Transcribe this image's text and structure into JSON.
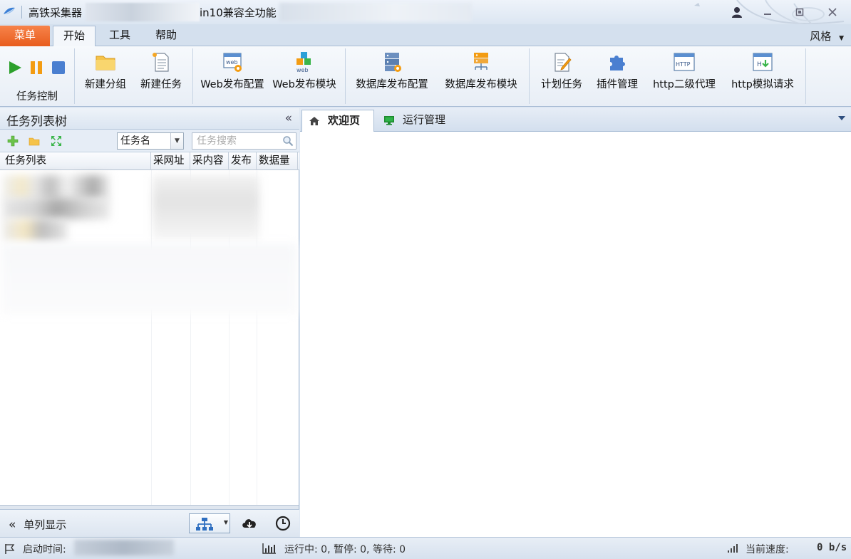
{
  "window": {
    "title": "高铁采集器",
    "title_suffix": "in10兼容全功能"
  },
  "ribbon_tabs": {
    "menu": "菜单",
    "home": "开始",
    "tools": "工具",
    "help": "帮助",
    "style": "风格"
  },
  "ribbon": {
    "task_control": "任务控制",
    "new_group": "新建分组",
    "new_task": "新建任务",
    "web_publish_config": "Web发布配置",
    "web_publish_module": "Web发布模块",
    "db_publish_config": "数据库发布配置",
    "db_publish_module": "数据库发布模块",
    "scheduled_task": "计划任务",
    "plugin_manage": "插件管理",
    "http_proxy": "http二级代理",
    "http_request": "http模拟请求"
  },
  "left_panel": {
    "title": "任务列表树",
    "collapse": "«",
    "filter_selected": "任务名",
    "search_placeholder": "任务搜索",
    "columns": [
      "任务列表",
      "采网址",
      "采内容",
      "发布",
      "数据量"
    ],
    "single_column": "单列显示"
  },
  "right_panel": {
    "tabs": [
      "欢迎页",
      "运行管理"
    ]
  },
  "status": {
    "start_time_label": "启动时间:",
    "run_status": "运行中: 0,  暂停: 0,  等待: 0",
    "speed_label": "当前速度:",
    "speed_value": "0 b/s"
  },
  "icons": {
    "play": "play-icon",
    "pause": "pause-icon",
    "stop": "stop-icon",
    "folder": "folder-icon",
    "document": "document-icon",
    "web": "web-icon",
    "database": "database-icon",
    "plugin": "puzzle-icon",
    "home": "home-icon",
    "monitor": "monitor-icon"
  },
  "colors": {
    "accent": "#e85d1e",
    "play": "#2ca02c",
    "pause": "#f39c12",
    "stop": "#4a7fd0"
  }
}
